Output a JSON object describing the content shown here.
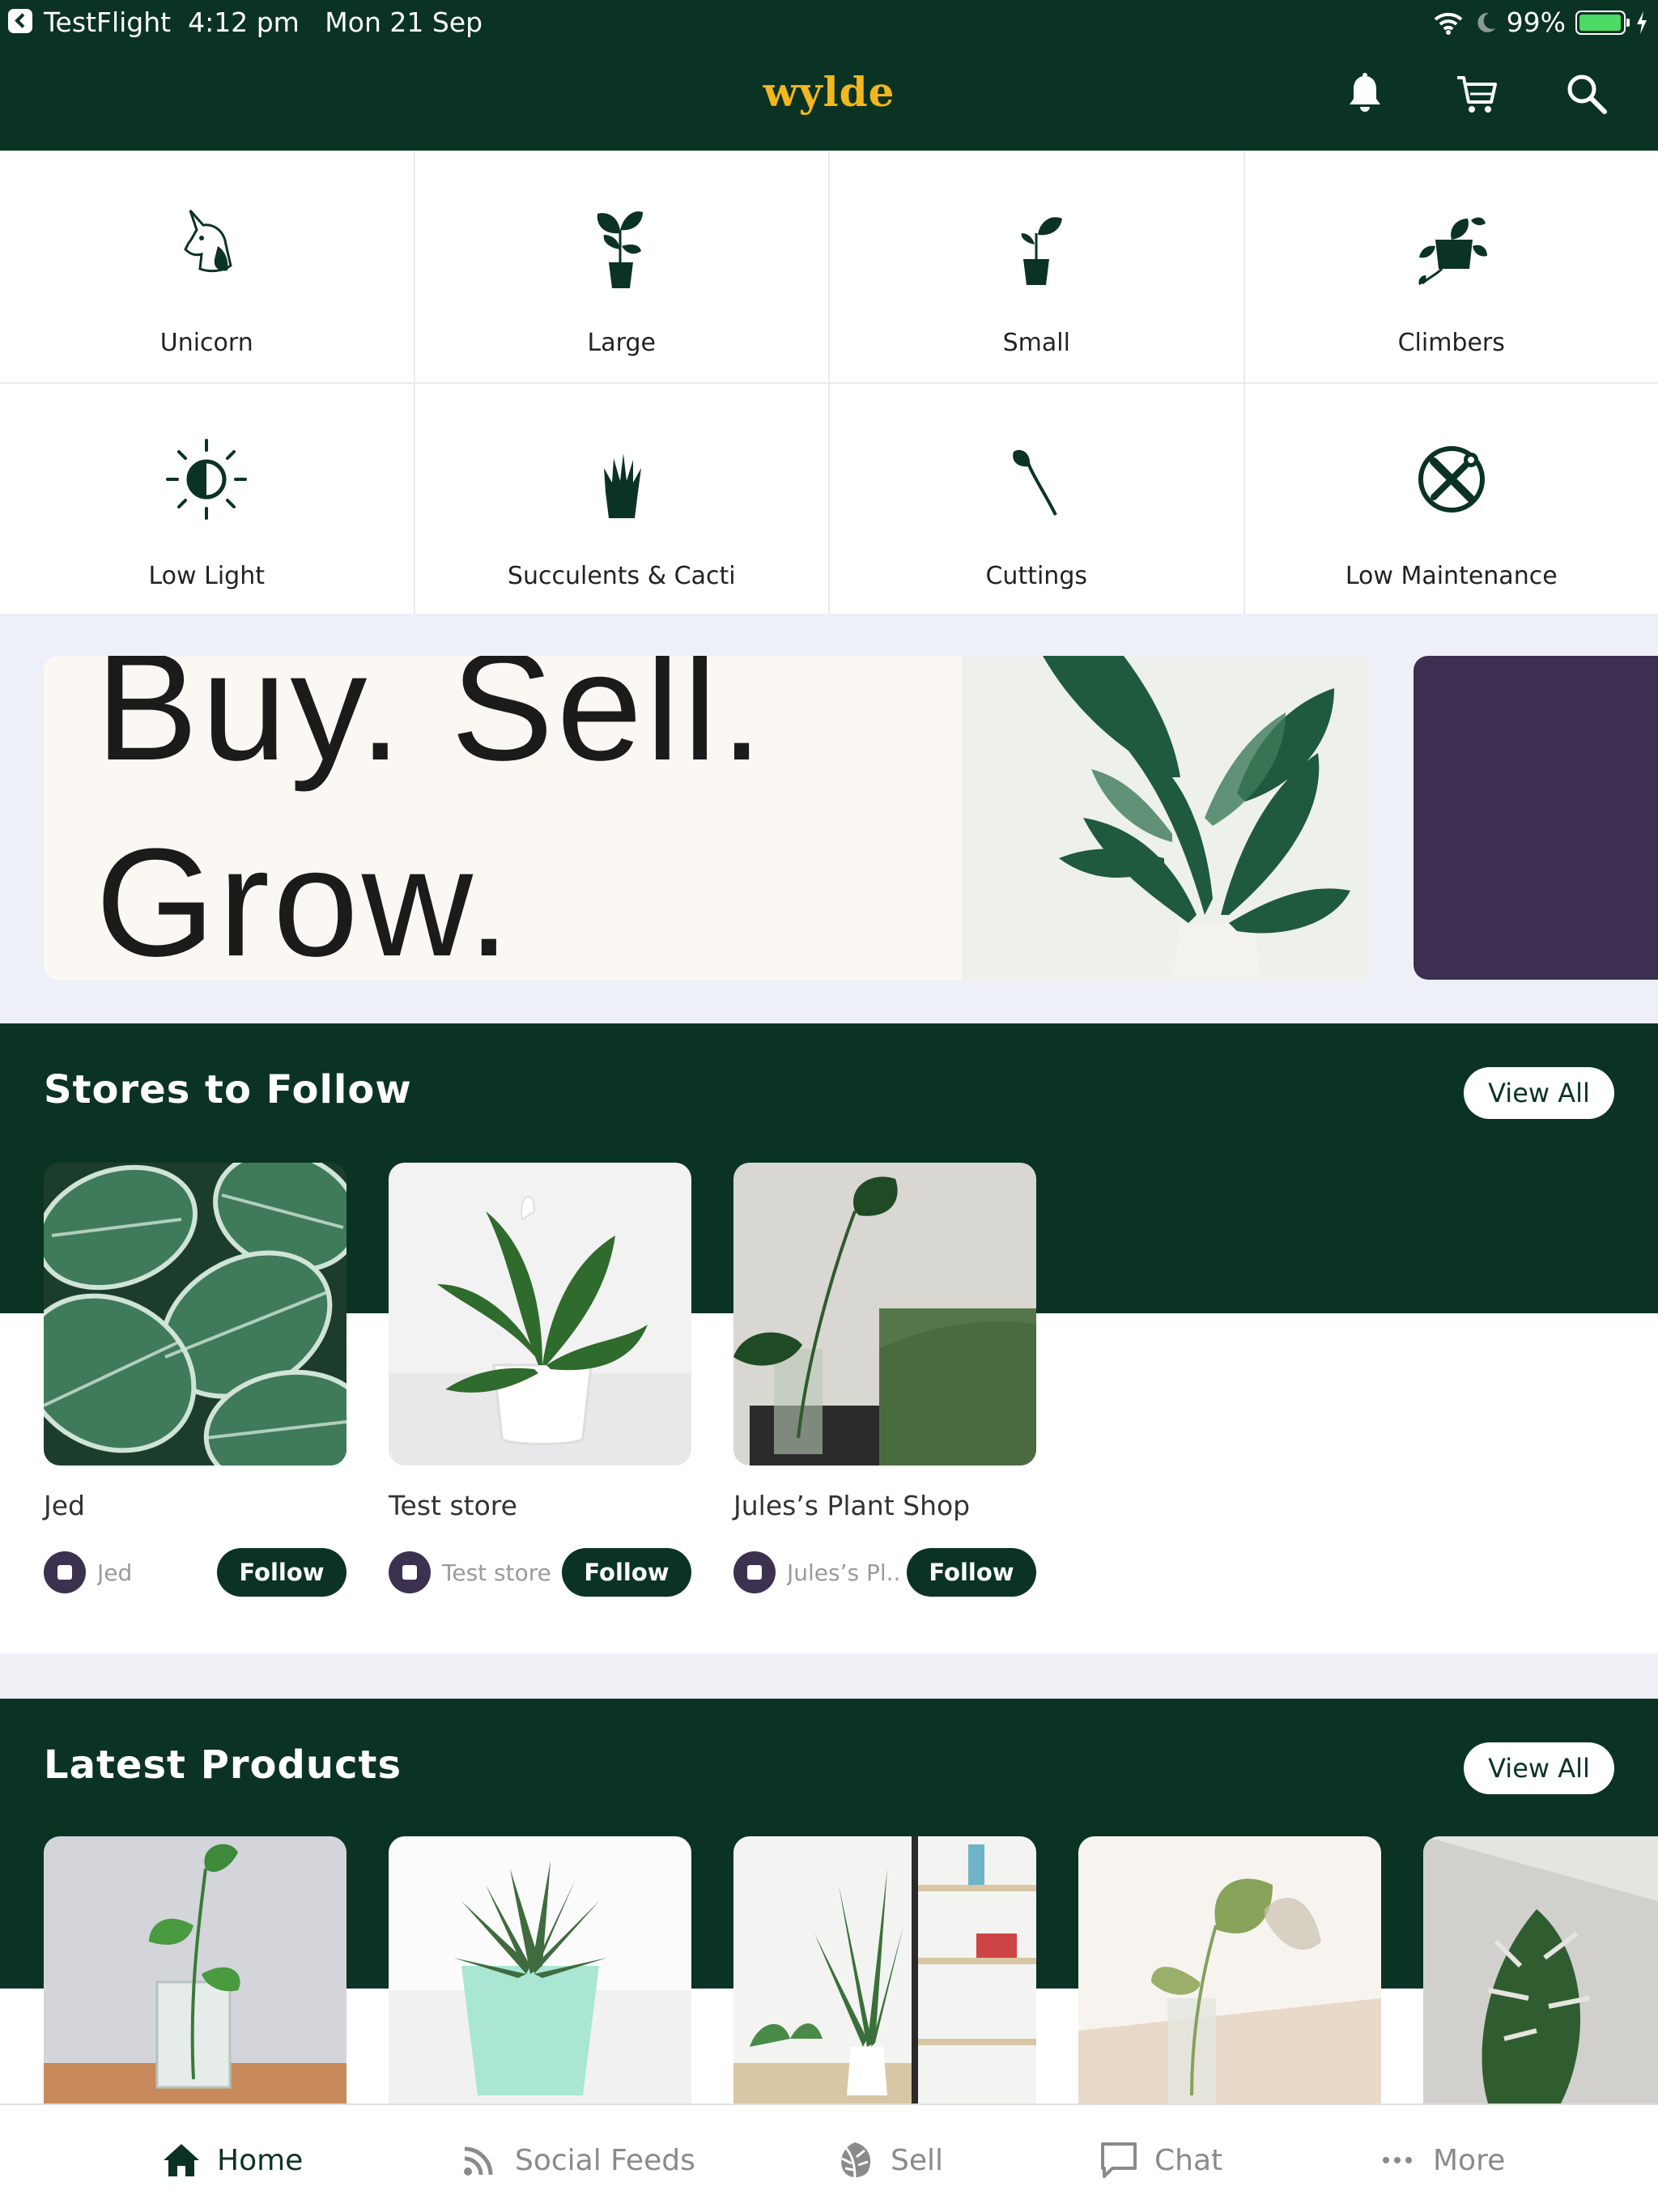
{
  "status_bar": {
    "app": "TestFlight",
    "time": "4:12 pm",
    "date": "Mon 21 Sep",
    "battery_text": "99%",
    "battery_level": 0.99
  },
  "header": {
    "logo": "wylde",
    "icons": [
      "bell-icon",
      "cart-icon",
      "search-icon"
    ]
  },
  "categories": [
    {
      "label": "Unicorn",
      "icon": "unicorn-icon"
    },
    {
      "label": "Large",
      "icon": "large-plant-icon"
    },
    {
      "label": "Small",
      "icon": "small-plant-icon"
    },
    {
      "label": "Climbers",
      "icon": "climber-plant-icon"
    },
    {
      "label": "Low Light",
      "icon": "low-light-icon"
    },
    {
      "label": "Succulents & Cacti",
      "icon": "succulent-icon"
    },
    {
      "label": "Cuttings",
      "icon": "cutting-icon"
    },
    {
      "label": "Low Maintenance",
      "icon": "tools-icon"
    }
  ],
  "banner": {
    "line1": "Buy. Sell.",
    "line2": "Grow."
  },
  "stores_section": {
    "title": "Stores to Follow",
    "view_all": "View All",
    "stores": [
      {
        "name": "Jed",
        "owner": "Jed",
        "follow": "Follow"
      },
      {
        "name": "Test store",
        "owner": "Test store",
        "follow": "Follow"
      },
      {
        "name": "Jules’s Plant Shop",
        "owner": "Jules’s Pl...",
        "follow": "Follow"
      }
    ]
  },
  "products_section": {
    "title": "Latest Products",
    "view_all": "View All"
  },
  "tab_bar": [
    {
      "label": "Home",
      "icon": "home-icon",
      "active": true
    },
    {
      "label": "Social Feeds",
      "icon": "rss-icon",
      "active": false
    },
    {
      "label": "Sell",
      "icon": "leaf-icon",
      "active": false
    },
    {
      "label": "Chat",
      "icon": "chat-icon",
      "active": false
    },
    {
      "label": "More",
      "icon": "more-icon",
      "active": false
    }
  ],
  "colors": {
    "brand_dark": "#0b3324",
    "logo_gold": "#f2b71e",
    "banner_purple": "#3c2f52"
  }
}
